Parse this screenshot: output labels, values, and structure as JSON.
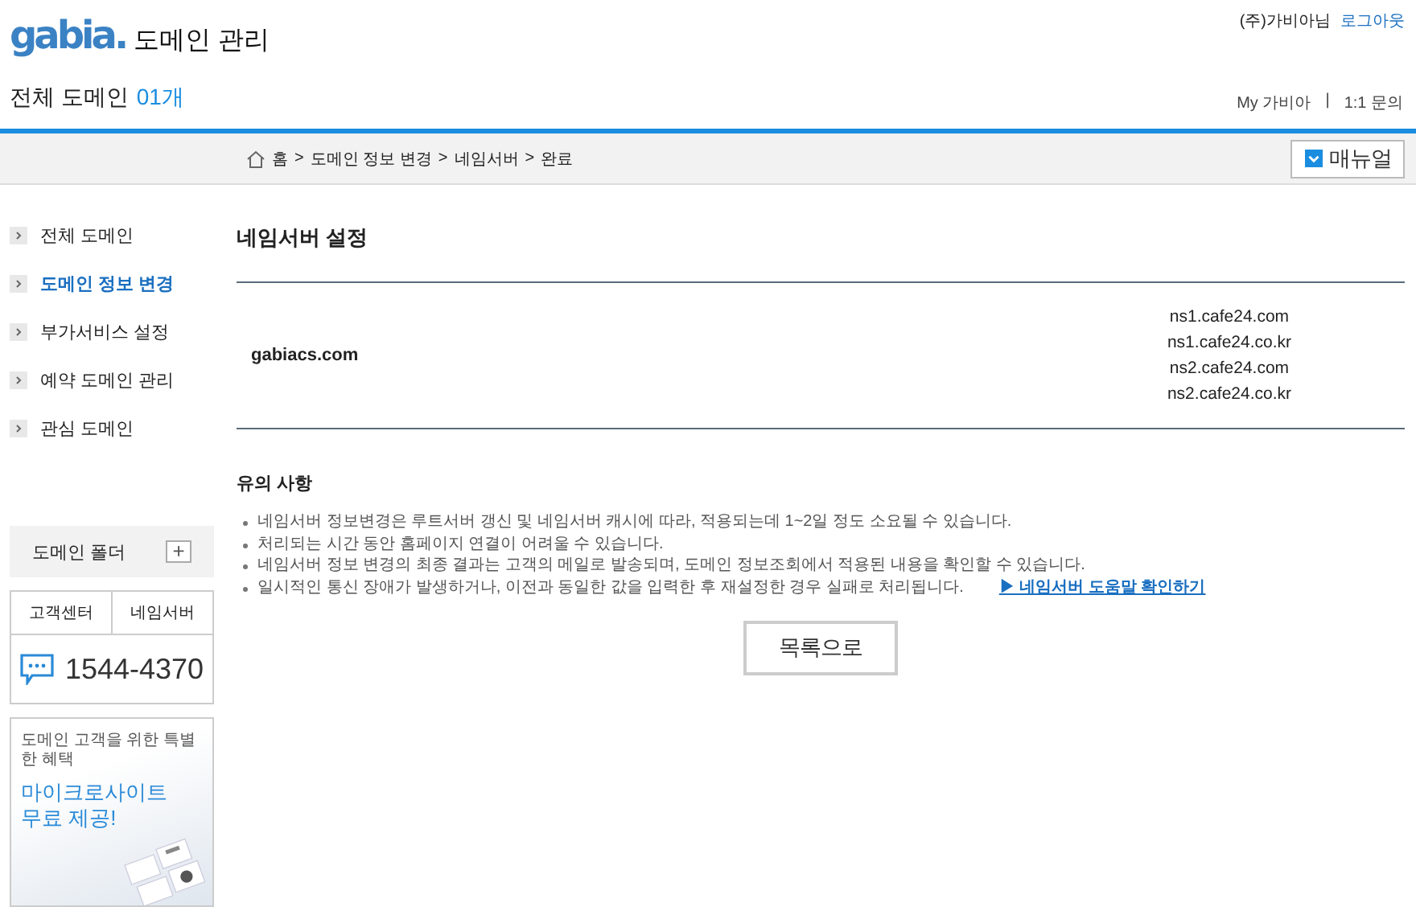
{
  "header": {
    "logo": "gabia.",
    "title": "도메인 관리",
    "user": "(주)가비아님",
    "logout": "로그아웃",
    "domain_label": "전체 도메인",
    "domain_count": "01개",
    "links": [
      "My 가비아",
      "1:1 문의"
    ],
    "link_separator": "|"
  },
  "breadcrumb": {
    "items": [
      "홈",
      "도메인 정보 변경",
      "네임서버",
      "완료"
    ],
    "separator": ">",
    "manual_button": "매뉴얼"
  },
  "sidebar": {
    "items": [
      {
        "label": "전체 도메인",
        "selected": false
      },
      {
        "label": "도메인 정보 변경",
        "selected": true
      },
      {
        "label": "부가서비스 설정",
        "selected": false
      },
      {
        "label": "예약 도메인 관리",
        "selected": false
      },
      {
        "label": "관심 도메인",
        "selected": false
      }
    ],
    "folder": {
      "label": "도메인 폴더",
      "add": "+"
    },
    "support": {
      "tabs": [
        "고객센터",
        "네임서버"
      ],
      "phone": "1544-4370"
    },
    "banner": {
      "subtitle": "도메인 고객을 위한 특별한 혜택",
      "headline": [
        "마이크로사이트",
        "무료 제공!"
      ]
    }
  },
  "main": {
    "title": "네임서버 설정",
    "domain": "gabiacs.com",
    "nameservers": [
      "ns1.cafe24.com",
      "ns1.cafe24.co.kr",
      "ns2.cafe24.com",
      "ns2.cafe24.co.kr"
    ],
    "notes_title": "유의 사항",
    "notes": [
      "네임서버 정보변경은 루트서버 갱신 및 네임서버 캐시에 따라, 적용되는데 1~2일 정도 소요될 수 있습니다.",
      "처리되는 시간 동안 홈페이지 연결이 어려울 수 있습니다.",
      "네임서버 정보 변경의 최종 결과는 고객의 메일로 발송되며, 도메인 정보조회에서 적용된 내용을 확인할 수 있습니다.",
      "일시적인 통신 장애가 발생하거나, 이전과 동일한 값을 입력한 후 재설정한 경우 실패로 처리됩니다."
    ],
    "help_link": "▶ 네임서버 도움말 확인하기",
    "back_button": "목록으로"
  }
}
